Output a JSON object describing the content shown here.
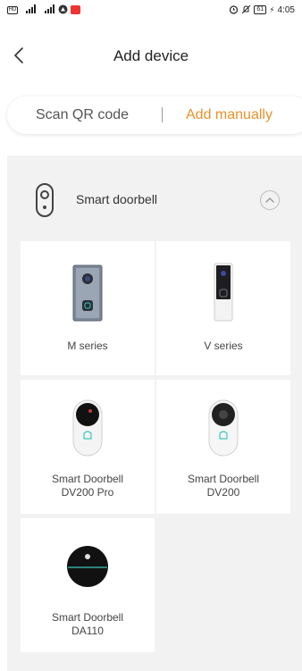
{
  "status_bar": {
    "left_icons": [
      "hd-icon",
      "signal-icon",
      "signal-icon",
      "app-icon",
      "notification-icon"
    ],
    "signal_1": "4G",
    "signal_2": "3G",
    "battery": "61",
    "time": "4:05"
  },
  "header": {
    "title": "Add device"
  },
  "tabs": {
    "scan_label": "Scan QR code",
    "manual_label": "Add manually",
    "active": "manual",
    "accent_color": "#e8922b"
  },
  "category": {
    "label": "Smart doorbell",
    "expanded": true
  },
  "devices": [
    {
      "line1": "M series",
      "line2": ""
    },
    {
      "line1": "V series",
      "line2": ""
    },
    {
      "line1": "Smart Doorbell",
      "line2": "DV200 Pro"
    },
    {
      "line1": "Smart Doorbell",
      "line2": "DV200"
    },
    {
      "line1": "Smart Doorbell",
      "line2": "DA110"
    }
  ]
}
